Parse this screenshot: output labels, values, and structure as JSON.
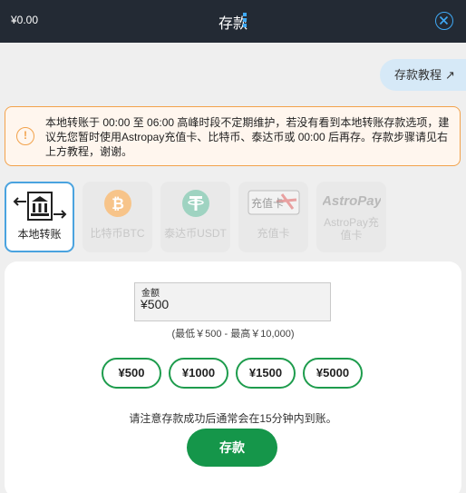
{
  "header": {
    "balance": "¥0.00",
    "title": "存款"
  },
  "tutorial": {
    "label": "存款教程",
    "arrow": "↗"
  },
  "notice": {
    "icon": "!",
    "text": "本地转账于 00:00 至 06:00 高峰时段不定期维护，若没有看到本地转账存款选项，建议先您暂时使用Astropay充值卡、比特币、泰达币或 00:00 后再存。存款步骤请见右上方教程，谢谢。"
  },
  "methods": [
    {
      "label": "本地转账",
      "icon": "bank-transfer-icon"
    },
    {
      "label": "比特币BTC",
      "icon": "bitcoin-icon"
    },
    {
      "label": "泰达币USDT",
      "icon": "tether-icon"
    },
    {
      "label": "充值卡",
      "icon": "recharge-card-icon"
    },
    {
      "label": "AstroPay充值卡",
      "icon": "astropay-icon",
      "logo_text": "AstroPay"
    }
  ],
  "recharge_card_logo": "充值卡",
  "amount": {
    "label": "金额",
    "value": "¥500",
    "range": "(最低￥500 - 最高￥10,000)"
  },
  "quick_amounts": [
    "¥500",
    "¥1000",
    "¥1500",
    "¥5000"
  ],
  "hint": "请注意存款成功后通常会在15分钟内到账。",
  "submit_label": "存款",
  "colors": {
    "header_bg": "#232a34",
    "accent_blue": "#3fa9f5",
    "accent_green": "#15964a",
    "warning_orange": "#f2a24b",
    "bitcoin": "#f7931a",
    "tether": "#26a17b"
  }
}
